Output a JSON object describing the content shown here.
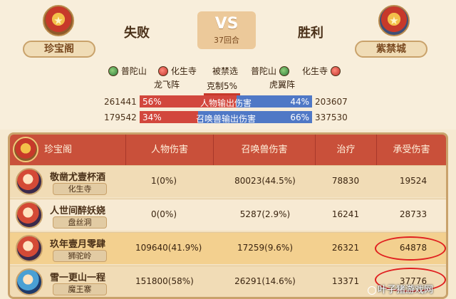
{
  "header": {
    "left_team": "珍宝阁",
    "right_team": "紫禁城",
    "left_result": "失败",
    "right_result": "胜利",
    "vs": "VS",
    "round": "37回合"
  },
  "schools": {
    "left": [
      "普陀山",
      "化生寺"
    ],
    "middle": "被禁选",
    "right": [
      "普陀山",
      "化生寺"
    ],
    "left_formation": "龙飞阵",
    "right_formation": "虎翼阵",
    "counter": "克制5%"
  },
  "stats": [
    {
      "left_value": "261441",
      "left_pct": "56%",
      "label": "人物输出伤害",
      "right_pct": "44%",
      "right_value": "203607",
      "left_share": 0.56
    },
    {
      "left_value": "179542",
      "left_pct": "34%",
      "label": "召唤兽输出伤害",
      "right_pct": "66%",
      "right_value": "337530",
      "left_share": 0.34
    }
  ],
  "table": {
    "team": "珍宝阁",
    "headers": [
      "人物伤害",
      "召唤兽伤害",
      "治疗",
      "承受伤害"
    ],
    "rows": [
      {
        "name": "敬凿尤壹杯酒",
        "school": "化生寺",
        "char_dmg": "1(0%)",
        "pet_dmg": "80023(44.5%)",
        "heal": "78830",
        "taken": "19524"
      },
      {
        "name": "人世间醉妖娆",
        "school": "盘丝洞",
        "char_dmg": "0(0%)",
        "pet_dmg": "5287(2.9%)",
        "heal": "16241",
        "taken": "28733"
      },
      {
        "name": "玖年壹月零肆",
        "school": "狮驼岭",
        "char_dmg": "109640(41.9%)",
        "pet_dmg": "17259(9.6%)",
        "heal": "26321",
        "taken": "64878"
      },
      {
        "name": "雪一更山一程",
        "school": "魔王寨",
        "char_dmg": "151800(58%)",
        "pet_dmg": "26291(14.6%)",
        "heal": "13371",
        "taken": "37776"
      }
    ]
  },
  "watermark": "叶子猪游戏网",
  "colors": {
    "red_bar": "#d2473d",
    "blue_bar": "#4f78c6",
    "header_bg": "#c9503a",
    "highlight_circle": "#e02020"
  }
}
